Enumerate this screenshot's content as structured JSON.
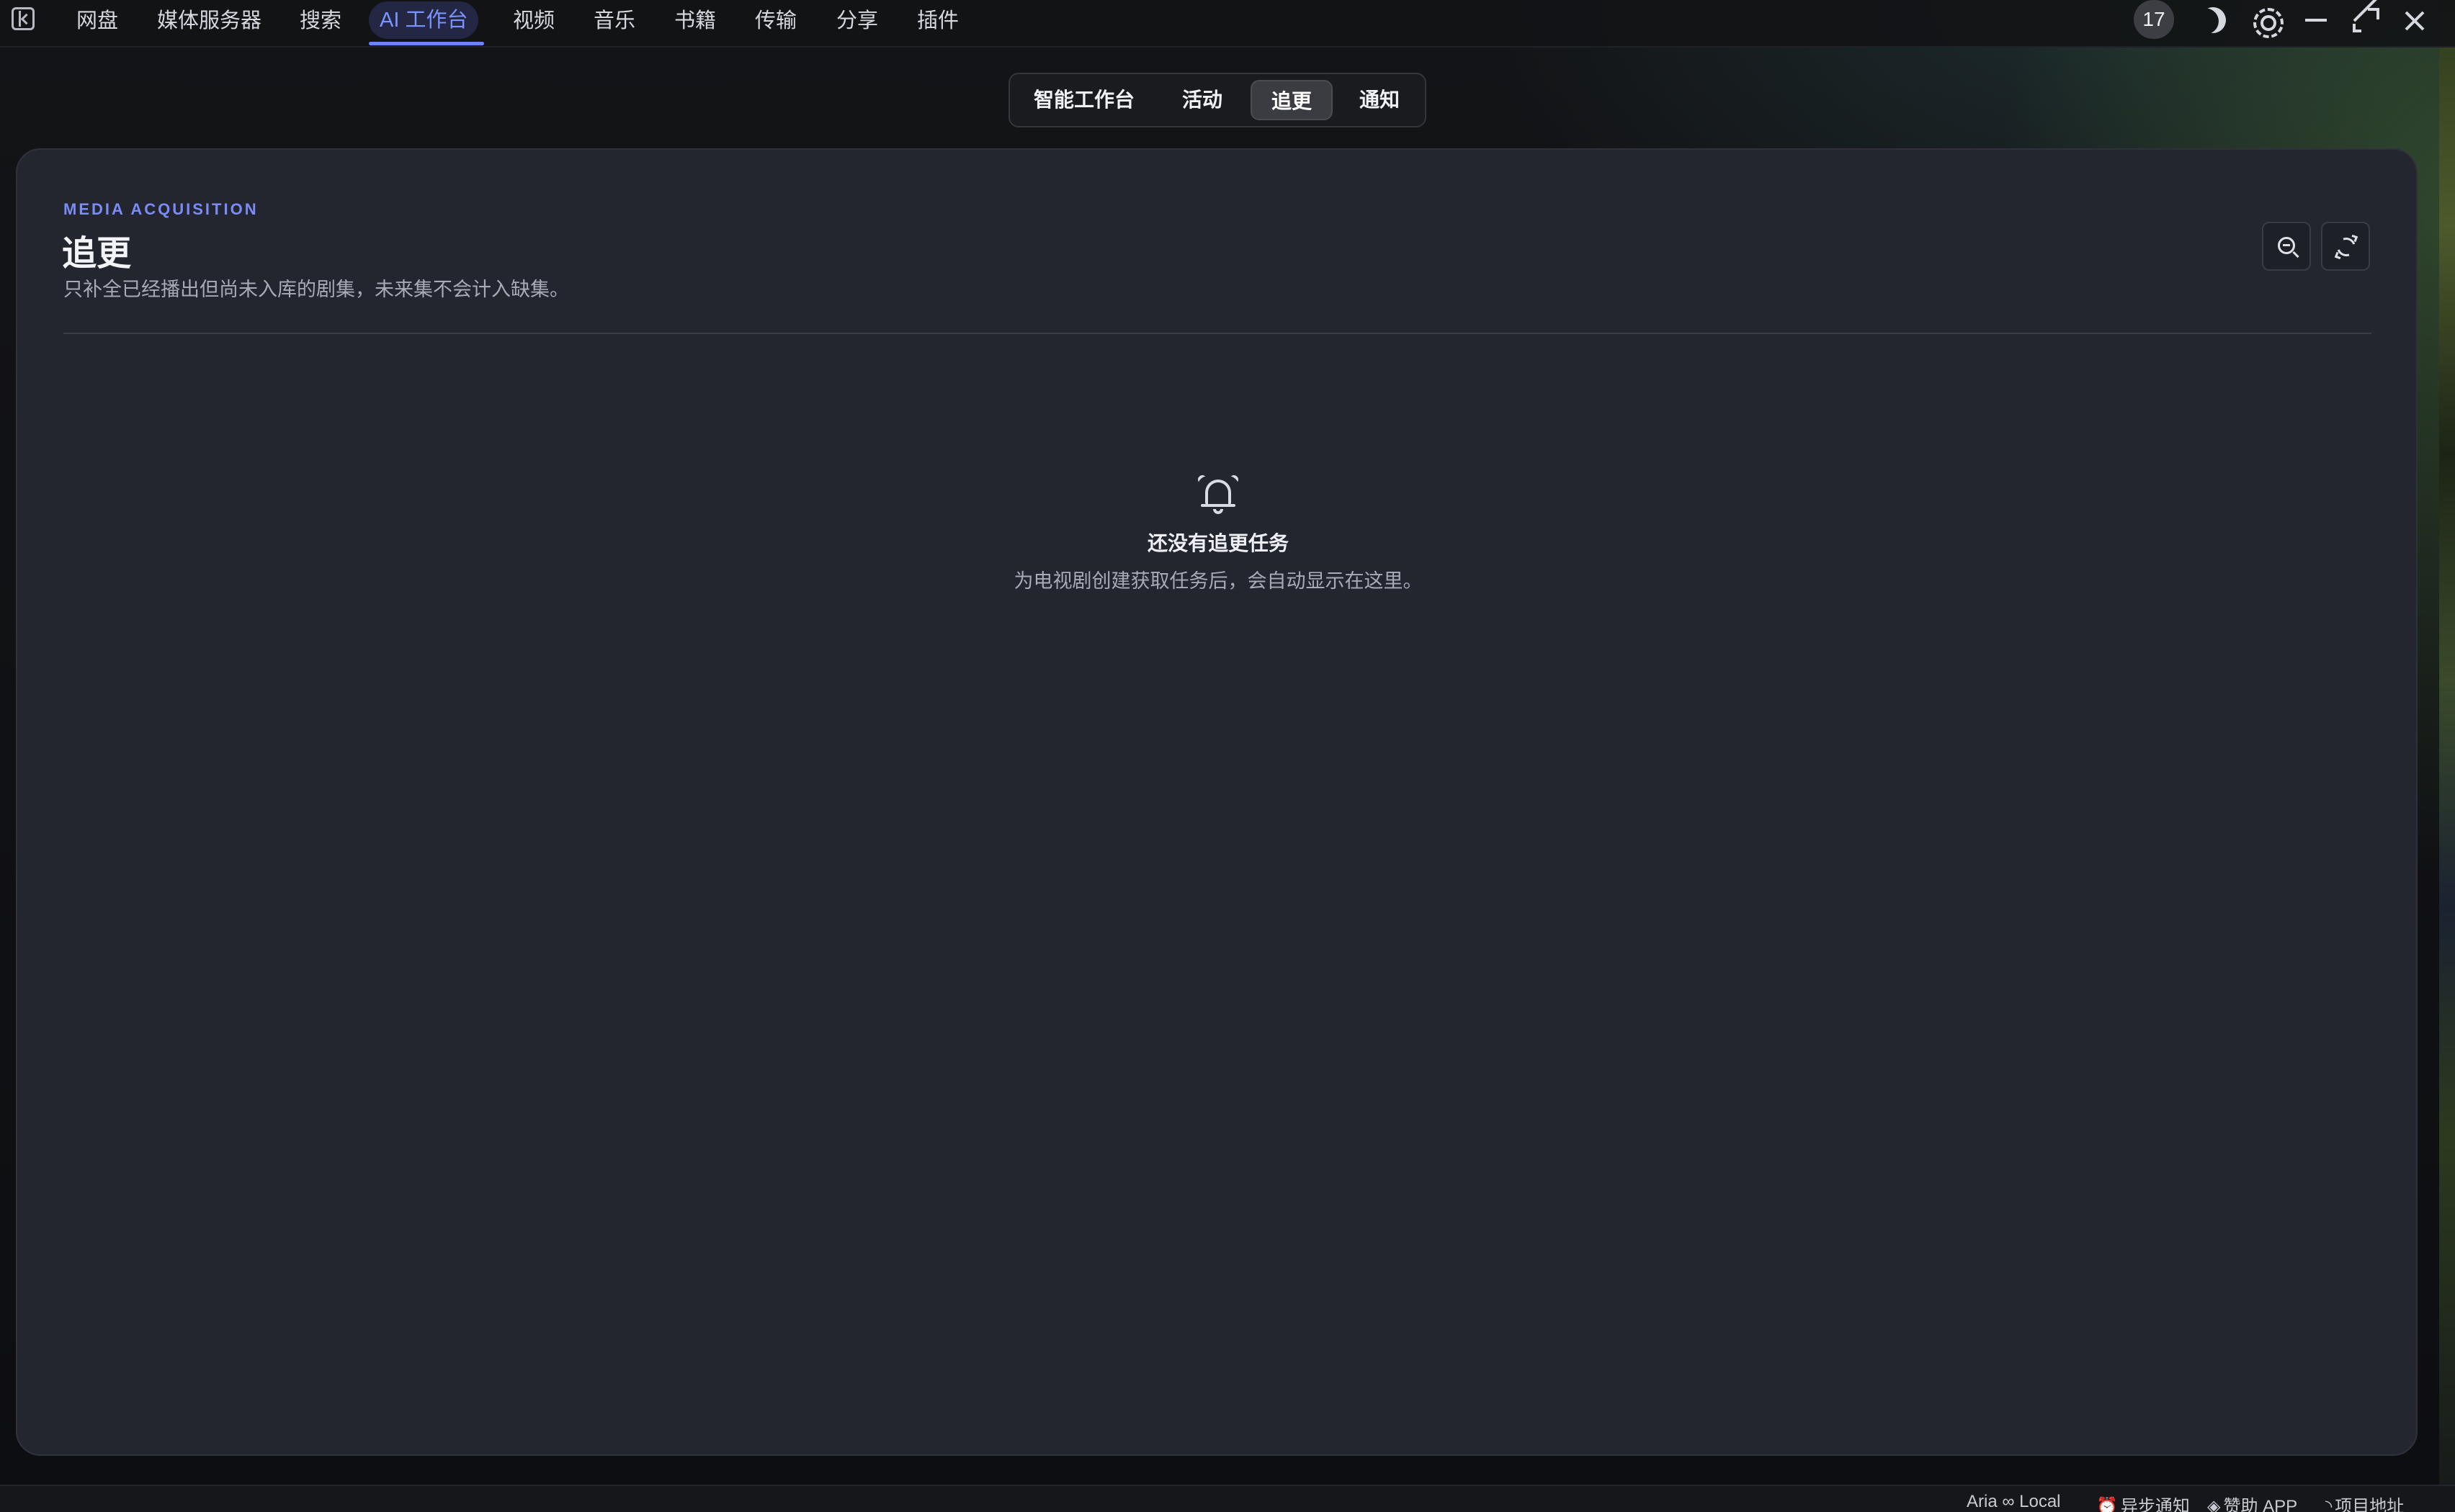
{
  "nav": {
    "items": [
      {
        "label": "网盘"
      },
      {
        "label": "媒体服务器"
      },
      {
        "label": "搜索"
      },
      {
        "label": "AI 工作台"
      },
      {
        "label": "视频"
      },
      {
        "label": "音乐"
      },
      {
        "label": "书籍"
      },
      {
        "label": "传输"
      },
      {
        "label": "分享"
      },
      {
        "label": "插件"
      }
    ],
    "active_index": 3
  },
  "window": {
    "badge_count": "17",
    "icons": [
      "moon-icon",
      "gear-icon",
      "minimize-icon",
      "maximize-icon",
      "close-icon"
    ]
  },
  "tabs": {
    "items": [
      {
        "label": "智能工作台"
      },
      {
        "label": "活动"
      },
      {
        "label": "追更"
      },
      {
        "label": "通知"
      }
    ],
    "active_index": 2
  },
  "panel": {
    "eyebrow": "MEDIA ACQUISITION",
    "title": "追更",
    "description": "只补全已经播出但尚未入库的剧集，未来集不会计入缺集。",
    "actions": [
      "zoom-search-icon",
      "refresh-icon"
    ]
  },
  "empty_state": {
    "icon": "bell-icon",
    "title": "还没有追更任务",
    "description": "为电视剧创建获取任务后，会自动显示在这里。"
  },
  "status_bar": {
    "items": [
      {
        "label": "Aria ∞ Local",
        "icon": ""
      },
      {
        "label": "异步通知",
        "icon": "alarm-icon"
      },
      {
        "label": "赞助 APP",
        "icon": "layers-icon"
      },
      {
        "label": "项目地址",
        "icon": "rss-icon"
      }
    ]
  },
  "colors": {
    "accent": "#7b93ff",
    "card_bg": "#23252f",
    "app_bg": "#0f1013"
  }
}
